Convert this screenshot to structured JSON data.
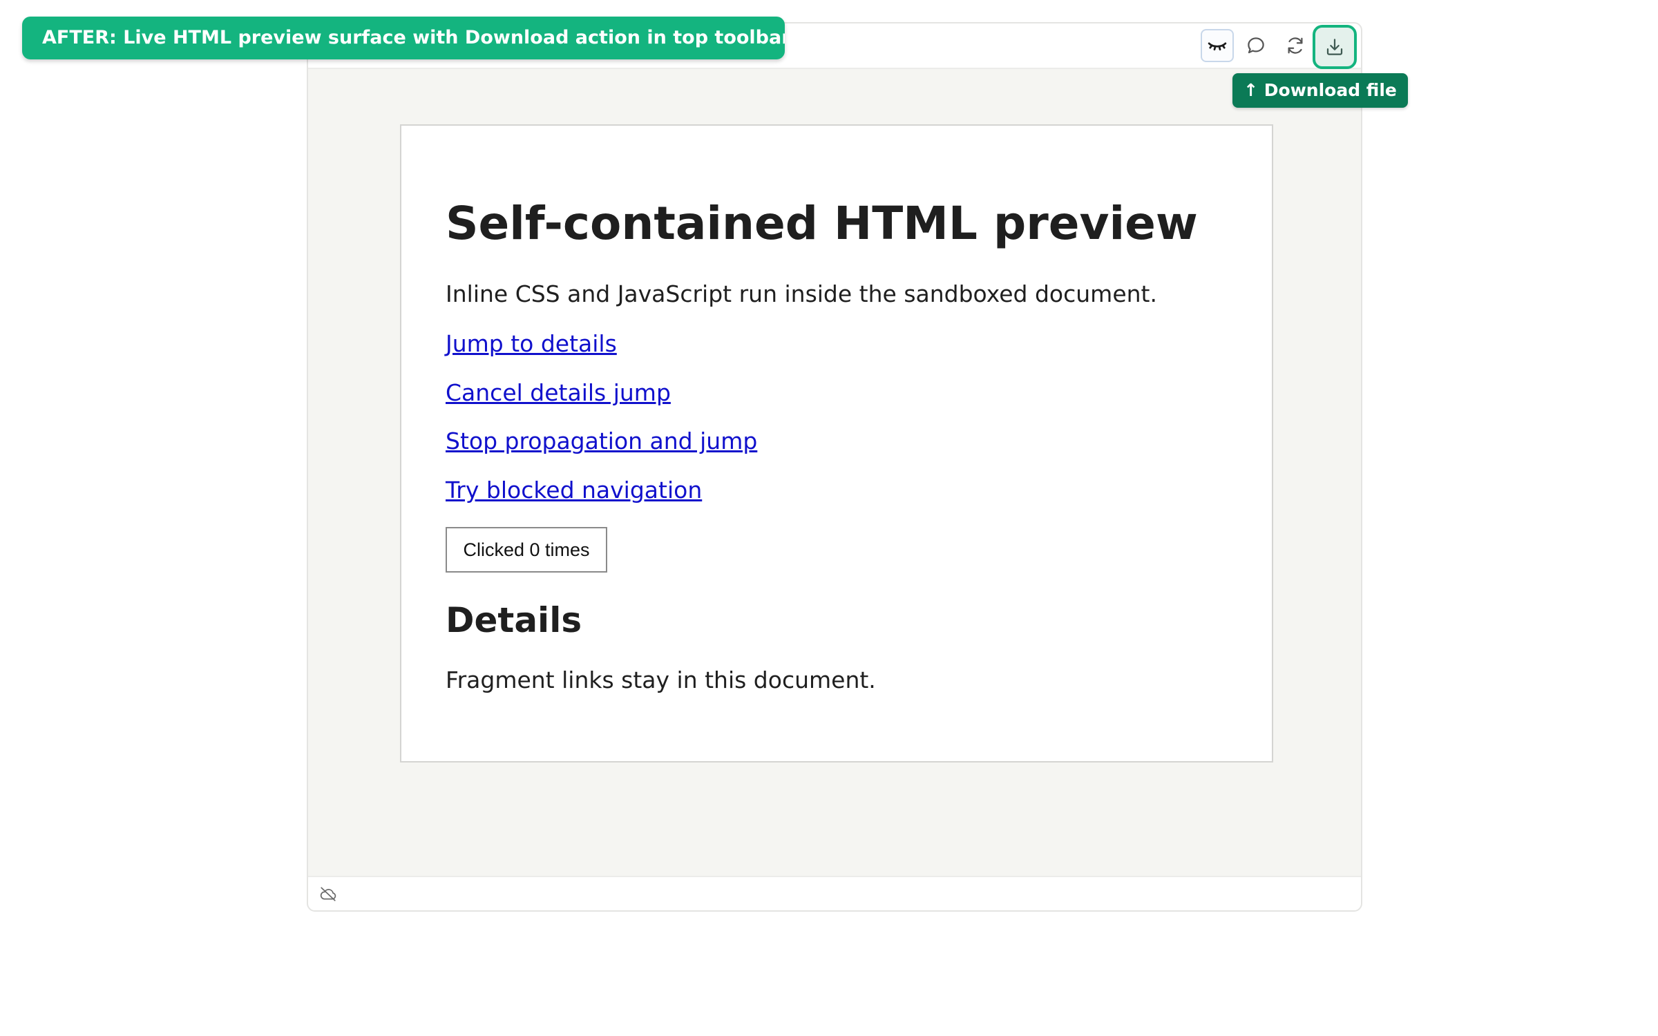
{
  "banner": {
    "text": "AFTER: Live HTML preview surface with Download action in top toolbar",
    "color": "#14b47f"
  },
  "toolbar": {
    "buttons": [
      {
        "icon": "closed-eye-icon",
        "state": "active"
      },
      {
        "icon": "comment-icon"
      },
      {
        "icon": "refresh-icon"
      },
      {
        "icon": "download-icon",
        "state": "highlighted"
      }
    ]
  },
  "tooltip": {
    "text": "↑ Download file",
    "color": "#0b7a56"
  },
  "document": {
    "title": "Self-contained HTML preview",
    "description": "Inline CSS and JavaScript run inside the sandboxed document.",
    "links": [
      "Jump to details",
      "Cancel details jump",
      "Stop propagation and jump",
      "Try blocked navigation"
    ],
    "counter_button": "Clicked 0 times",
    "details_heading": "Details",
    "details_text": "Fragment links stay in this document."
  },
  "statusbar": {
    "icon": "cloud-off-icon"
  },
  "colors": {
    "link": "#1010cc",
    "panel_background": "#f5f5f2",
    "accent": "#14b47f"
  }
}
